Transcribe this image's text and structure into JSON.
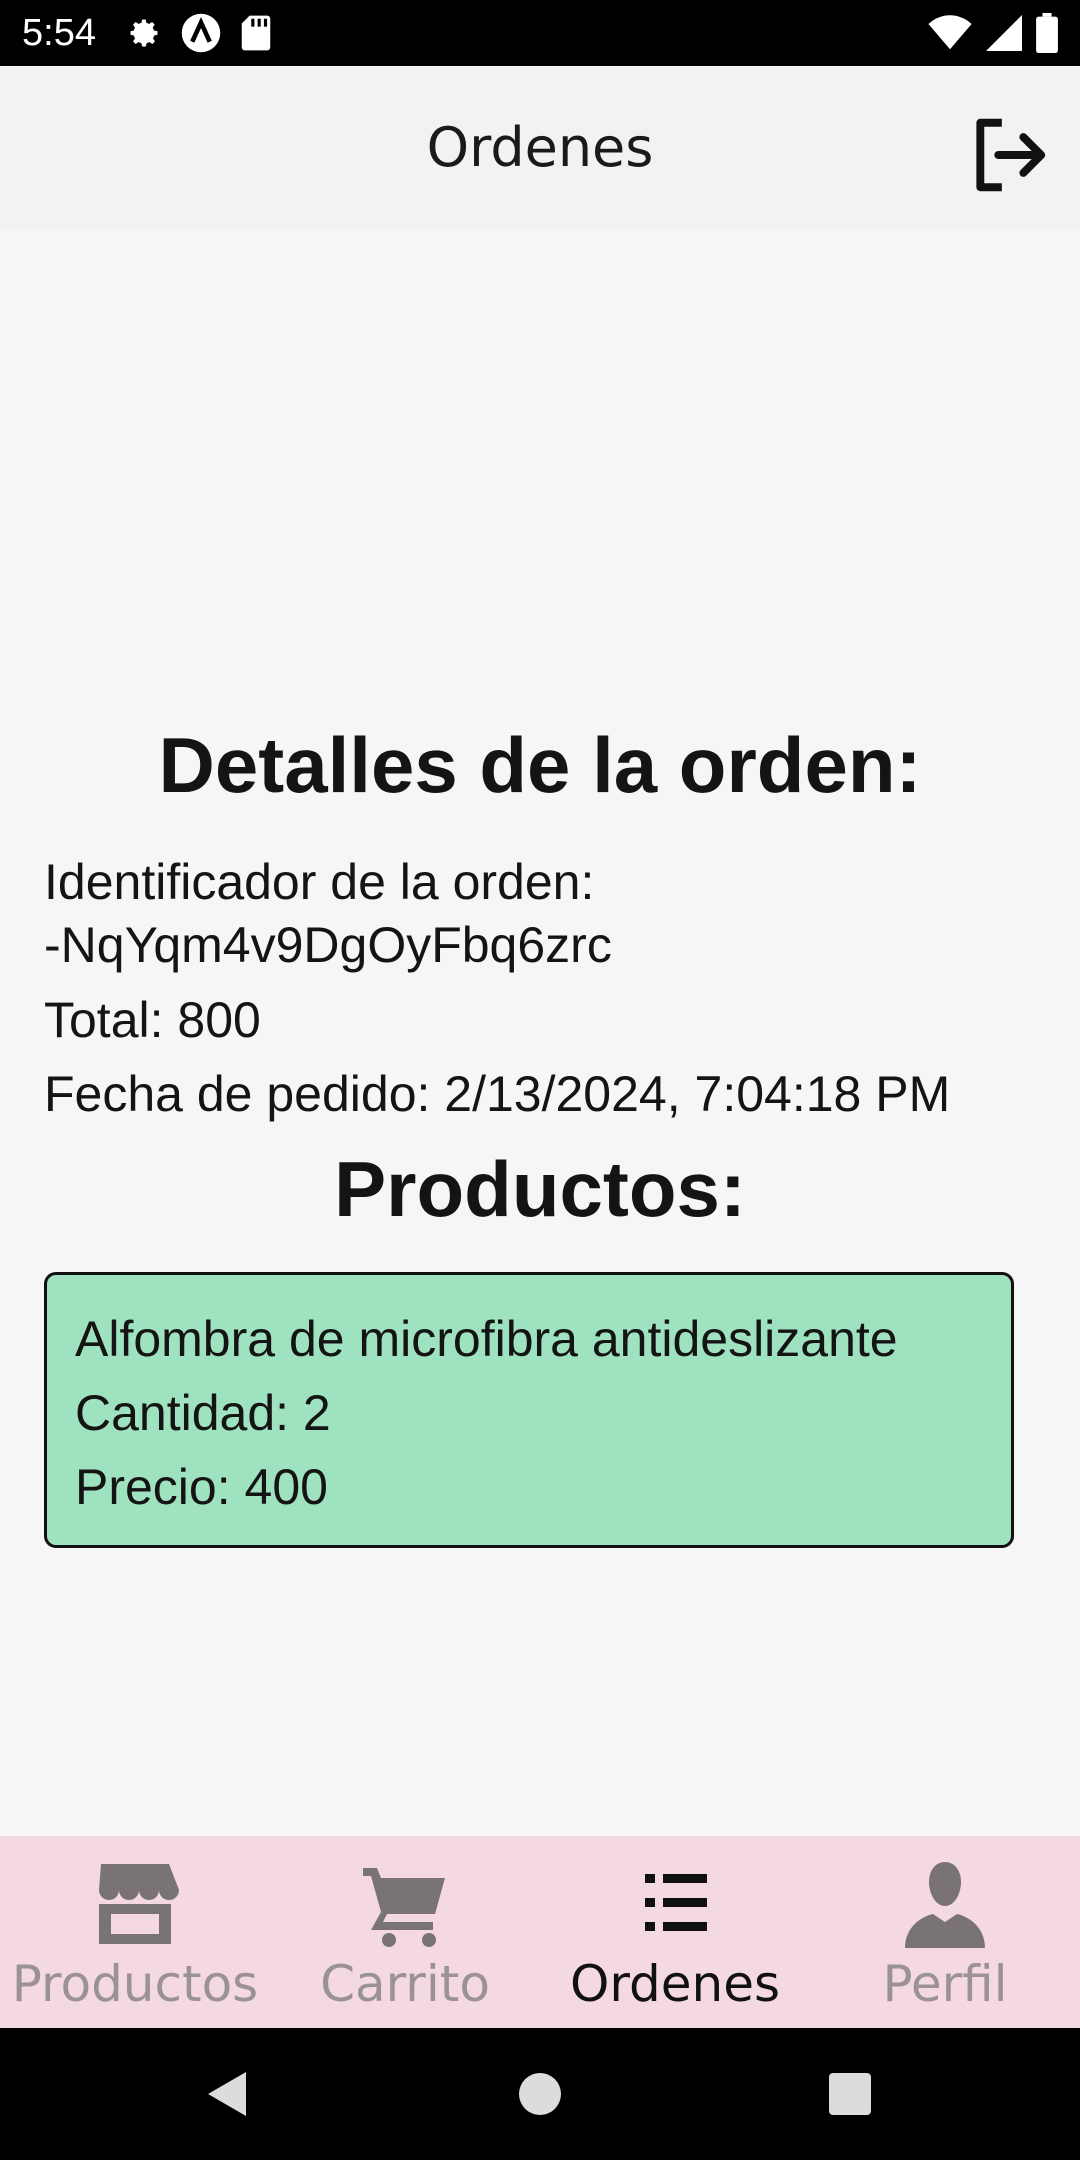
{
  "status_bar": {
    "time": "5:54",
    "left_icons": [
      "gear-icon",
      "a-icon",
      "sd-card-icon"
    ],
    "right_icons": [
      "wifi-icon",
      "signal-icon",
      "battery-icon"
    ]
  },
  "header": {
    "title": "Ordenes",
    "logout_icon": "logout-icon"
  },
  "order": {
    "heading": "Detalles de la orden:",
    "id_label": "Identificador de la orden:",
    "id_value": "-NqYqm4v9DgOyFbq6zrc",
    "total_line": "Total: 800",
    "date_line": "Fecha de pedido: 2/13/2024, 7:04:18 PM"
  },
  "products": {
    "heading": "Productos:",
    "items": [
      {
        "name": "Alfombra de microfibra antideslizante",
        "quantity_line": "Cantidad: 2",
        "price_line": "Precio: 400"
      }
    ]
  },
  "bottom_nav": {
    "items": [
      {
        "label": "Productos",
        "icon": "store-icon",
        "active": false
      },
      {
        "label": "Carrito",
        "icon": "cart-icon",
        "active": false
      },
      {
        "label": "Ordenes",
        "icon": "list-icon",
        "active": true
      },
      {
        "label": "Perfil",
        "icon": "person-icon",
        "active": false
      }
    ]
  },
  "colors": {
    "product_card_bg": "#9fe2bf",
    "bottom_nav_bg": "#f5d9e1",
    "inactive_tab": "#9b9296",
    "active_tab": "#111111"
  }
}
